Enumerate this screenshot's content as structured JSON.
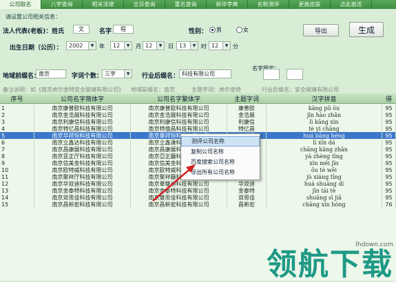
{
  "tabs": [
    {
      "label": "公司取名",
      "active": true
    },
    {
      "label": "八字查询",
      "active": false
    },
    {
      "label": "相关法律",
      "active": false
    },
    {
      "label": "吉日查询",
      "active": false
    },
    {
      "label": "重名查询",
      "active": false
    },
    {
      "label": "新华字典",
      "active": false
    },
    {
      "label": "名称测评",
      "active": false
    },
    {
      "label": "更换皮肤",
      "active": false
    },
    {
      "label": "点此激活",
      "active": false
    }
  ],
  "form": {
    "note_title": "请设置公司相关信息：",
    "legal_rep_label": "法人代表(老板)：姓氏",
    "surname": "文",
    "given_name_label": "名字",
    "given_name": "程",
    "gender_label": "性别：",
    "gender_male": "◉男",
    "gender_female": "○女",
    "male_text": "男",
    "female_text": "女",
    "birth_label": "出生日期（公历）：",
    "year": "2002",
    "year_unit": "年",
    "month": "12",
    "month_unit": "月",
    "day": "12",
    "day_unit": "日",
    "hour": "13",
    "hour_unit": "时",
    "minute": "12",
    "minute_unit": "分",
    "region_label": "地域前缀名：",
    "region": "南京",
    "char_count_label": "字词个数：",
    "char_count": "三字",
    "industry_label": "行业后缀名：",
    "industry": "科技有限公司",
    "fixed_char_label": "名字限定：",
    "export_button": "导出",
    "generate_button": "生成",
    "hint_example": "备注说明：如《南京虎尔金特安全玻璃有限公司》",
    "hint_region": "地域前缀名：南京",
    "hint_keyword": "主题字词：虎尔金特",
    "hint_industry": "行业后缀名：安全玻璃有限公司"
  },
  "table": {
    "headers": [
      "序号",
      "公司名字简体字",
      "公司名字繁体字",
      "主题字词",
      "汉字拼音",
      "得"
    ],
    "rows": [
      {
        "no": "1",
        "simp": "南京康普欧科技有限公司",
        "trad": "南京康普歐科技有限公司",
        "key": "康普欧",
        "py": "kāng pǔ ōu",
        "score": "95"
      },
      {
        "no": "2",
        "simp": "南京金浩展科技有限公司",
        "trad": "南京金浩展科技有限公司",
        "key": "金浩展",
        "py": "jīn hào zhǎn",
        "score": "95"
      },
      {
        "no": "3",
        "simp": "南京利康信科技有限公司",
        "trad": "南京利康信科技有限公司",
        "key": "利康信",
        "py": "lì kāng xìn",
        "score": "95"
      },
      {
        "no": "4",
        "simp": "南京特亿昌科技有限公司",
        "trad": "南京特億昌科技有限公司",
        "key": "特亿昌",
        "py": "tè yì chāng",
        "score": "95"
      },
      {
        "no": "5",
        "simp": "南京华邦恒科技有限公司",
        "trad": "南京華邦恒科技有限公司",
        "key": "华邦恒",
        "py": "huá bāng héng",
        "score": "95",
        "selected": true
      },
      {
        "no": "6",
        "simp": "南京立鑫达科技有限公司",
        "trad": "南京立鑫達科技有限公司",
        "key": "立鑫达",
        "py": "lì xīn dá",
        "score": "95"
      },
      {
        "no": "7",
        "simp": "南京昌康展科技有限公司",
        "trad": "南京昌康展科技有限公司",
        "key": "昌康展",
        "py": "chāng kāng zhǎn",
        "score": "95"
      },
      {
        "no": "8",
        "simp": "南京亚正厅科技有限公司",
        "trad": "南京亞正廳科技有限公司",
        "key": "亚正厅",
        "py": "yà zhèng tīng",
        "score": "95"
      },
      {
        "no": "9",
        "simp": "南京信美金科技有限公司",
        "trad": "南京信美金科技有限公司",
        "key": "信美金",
        "py": "xìn měi jīn",
        "score": "95"
      },
      {
        "no": "10",
        "simp": "南京欧特威科技有限公司",
        "trad": "南京歐特威科技有限公司",
        "key": "欧特威",
        "py": "ōu tè wēi",
        "score": "95"
      },
      {
        "no": "11",
        "simp": "南京聚祥厅科技有限公司",
        "trad": "南京聚祥廳科技有限公司",
        "key": "聚祥厅",
        "py": "jù xiáng tīng",
        "score": "95"
      },
      {
        "no": "12",
        "simp": "南京华双迪科技有限公司",
        "trad": "南京華雙迪科技有限公司",
        "key": "华双迪",
        "py": "huá shuāng dí",
        "score": "95"
      },
      {
        "no": "13",
        "simp": "南京金泰特科技有限公司",
        "trad": "南京金泰特科技有限公司",
        "key": "金泰特",
        "py": "jīn tài tè",
        "score": "95"
      },
      {
        "no": "14",
        "simp": "南京双思佳科技有限公司",
        "trad": "南京雙思佳科技有限公司",
        "key": "双思佳",
        "py": "shuāng sī jiā",
        "score": "95"
      },
      {
        "no": "15",
        "simp": "南京昌新宏科技有限公司",
        "trad": "南京昌新宏科技有限公司",
        "key": "昌新宏",
        "py": "chāng xīn hóng",
        "score": "76"
      }
    ]
  },
  "context_menu": {
    "items": [
      {
        "label": "测评公司名称",
        "highlighted": true
      },
      {
        "label": "复制公司名称",
        "highlighted": false
      },
      {
        "label": "百度搜索公司名称",
        "highlighted": false
      },
      {
        "label": "导出所有公司名称",
        "highlighted": false
      }
    ]
  },
  "watermark": {
    "url": "lhdown.com",
    "text": "领航下载"
  },
  "colors": {
    "tab_bar": "#3f8e40",
    "selected_row": "#3d77c9",
    "watermark": "#1f9a86",
    "arrow": "#d02020"
  }
}
